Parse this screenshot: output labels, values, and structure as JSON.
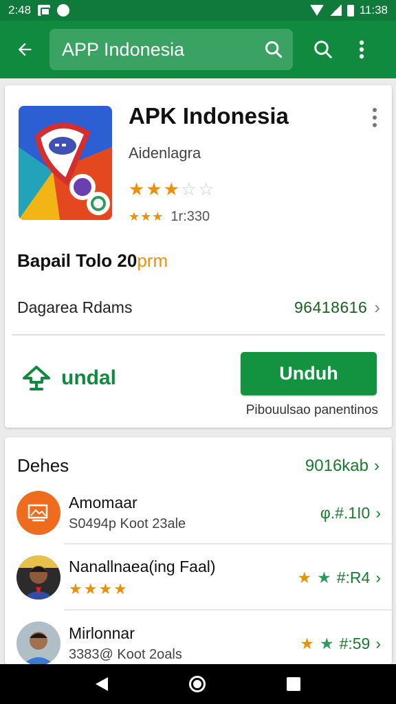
{
  "status_bar": {
    "time_left": "2:48",
    "time_right": "11:38"
  },
  "app_bar": {
    "search_text": "APP Indonesia"
  },
  "app_card": {
    "title": "APK Indonesia",
    "developer": "Aidenlagra",
    "rating_stars": 3,
    "rating_max": 5,
    "review_count": "1r:330",
    "promo_text": "Bapail Tolo 20",
    "promo_accent": "prm",
    "meta_label": "Dagarea Rdams",
    "meta_value": "96418616",
    "install_link_label": "undal",
    "primary_button_label": "Unduh",
    "button_caption": "Pibouulsao panentinos"
  },
  "list_section": {
    "title": "Dehes",
    "more_label": "9016kab",
    "items": [
      {
        "title": "Amomaar",
        "subtitle": "S0494p Koot 23ale",
        "right": "φ.#.1I0"
      },
      {
        "title": "Nanallnaea(ing Faal)",
        "stars": "★★★★",
        "right": "#:R4"
      },
      {
        "title": "Mirlonnar",
        "subtitle": "3383@ Koot 2oals",
        "right": "#:59"
      }
    ]
  },
  "colors": {
    "primary": "#0f8a3e",
    "primary_dark": "#0f7a3a",
    "button": "#13923f",
    "star": "#e8920c"
  },
  "icons": [
    "arrow-back-icon",
    "search-icon",
    "more-vert-icon",
    "download-cloud-icon",
    "chevron-right-icon"
  ]
}
